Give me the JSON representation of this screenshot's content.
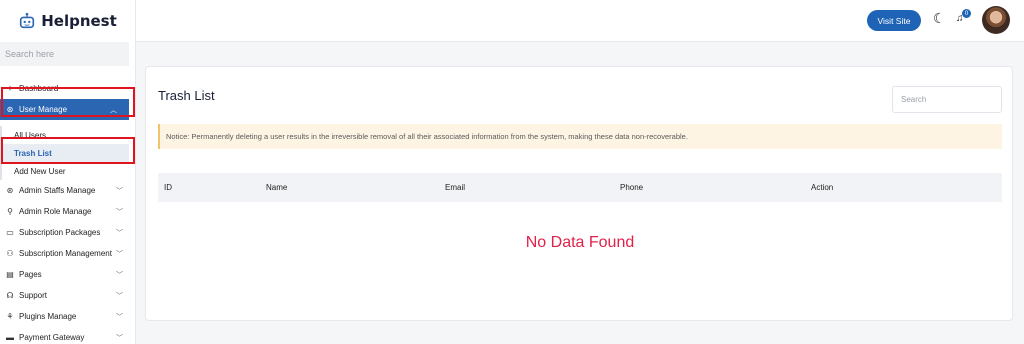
{
  "brand": {
    "name": "Helpnest"
  },
  "sidebar": {
    "search_placeholder": "Search here",
    "dashboard": "Dashboard",
    "user_manage": "User Manage",
    "user_sub": [
      "All Users",
      "Trash List",
      "Add New User"
    ],
    "items": [
      {
        "label": "Admin Staffs Manage",
        "icon": "user-circle-icon"
      },
      {
        "label": "Admin Role Manage",
        "icon": "user-role-icon"
      },
      {
        "label": "Subscription Packages",
        "icon": "calendar-icon"
      },
      {
        "label": "Subscription Management",
        "icon": "users-icon"
      },
      {
        "label": "Pages",
        "icon": "page-icon"
      },
      {
        "label": "Support",
        "icon": "support-icon"
      },
      {
        "label": "Plugins Manage",
        "icon": "plug-icon"
      },
      {
        "label": "Payment Gateway",
        "icon": "card-icon"
      }
    ]
  },
  "header": {
    "visit_site": "Visit Site",
    "notification_count": "0"
  },
  "main": {
    "title": "Trash List",
    "search_placeholder": "Search",
    "notice": "Notice: Permanently deleting a user results in the irreversible removal of all their associated information from the system, making these data non-recoverable.",
    "columns": [
      "ID",
      "Name",
      "Email",
      "Phone",
      "Action"
    ],
    "empty_text": "No Data Found"
  },
  "colors": {
    "accent": "#2b66b2",
    "highlight": "#e0141e",
    "empty_text": "#e0214a"
  }
}
